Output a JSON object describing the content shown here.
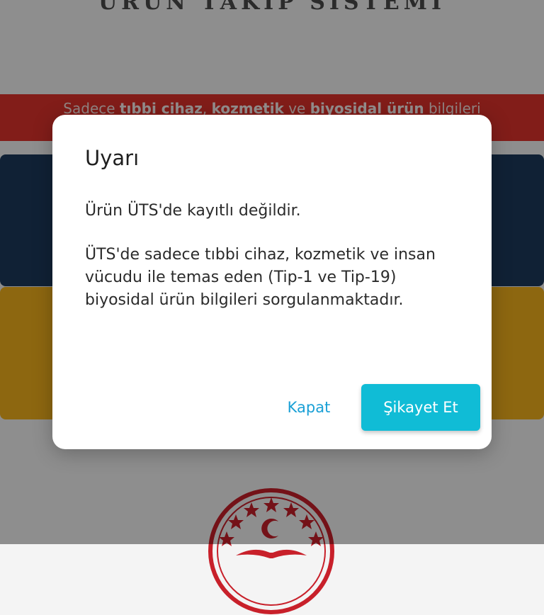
{
  "header": {
    "title": "ÜRÜN TAKİP SİSTEMİ"
  },
  "banner": {
    "prefix": "Sadece ",
    "bold1": "tıbbi cihaz",
    "sep1": ", ",
    "bold2": "kozmetik",
    "sep2": " ve ",
    "bold3": "biyosidal ürün",
    "suffix": " bilgileri"
  },
  "colors": {
    "banner": "#e0332c",
    "tile_navy": "#1d3a5c",
    "tile_yellow": "#f3b21d",
    "accent": "#10bcd6",
    "link": "#1aa0d6"
  },
  "icons": {
    "emblem": "ministry-emblem-icon"
  },
  "dialog": {
    "title": "Uyarı",
    "message_1": "Ürün ÜTS'de kayıtlı değildir.",
    "message_2": "ÜTS'de sadece tıbbi cihaz, kozmetik ve insan vücudu ile temas eden (Tip-1 ve Tip-19) biyosidal ürün bilgileri sorgulanmaktadır.",
    "close_label": "Kapat",
    "complain_label": "Şikayet Et"
  }
}
